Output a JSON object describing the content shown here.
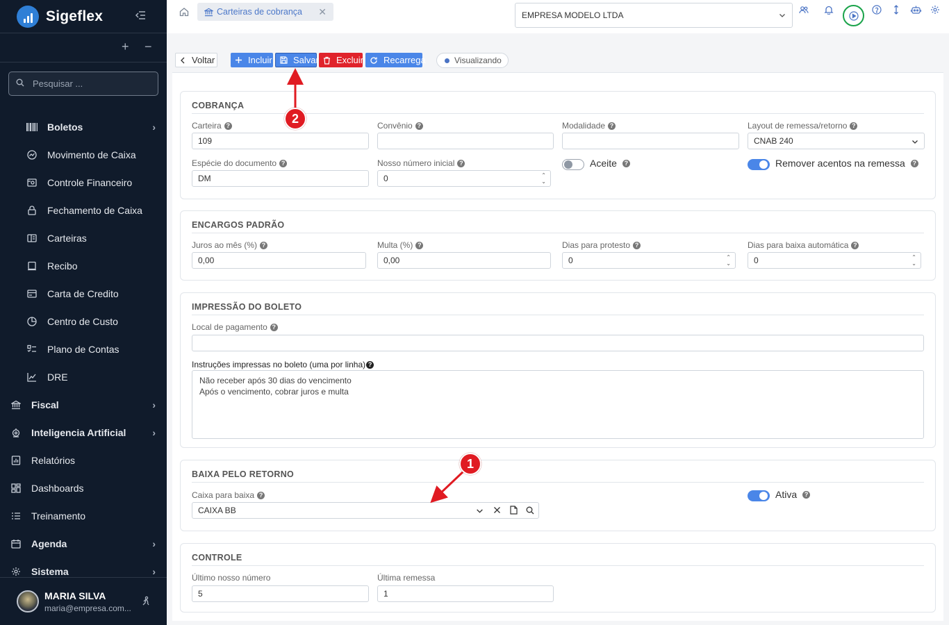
{
  "app": {
    "name": "Sigeflex",
    "search_placeholder": "Pesquisar ...",
    "tree_expand": "+",
    "tree_collapse": "−"
  },
  "sidebar": {
    "items": [
      {
        "label": "Boletos",
        "icon": "barcode-icon",
        "bold": true,
        "chevron": true
      },
      {
        "label": "Movimento de Caixa",
        "icon": "cash-flow-icon"
      },
      {
        "label": "Controle Financeiro",
        "icon": "finance-control-icon"
      },
      {
        "label": "Fechamento de Caixa",
        "icon": "lock-icon"
      },
      {
        "label": "Carteiras",
        "icon": "wallet-icon"
      },
      {
        "label": "Recibo",
        "icon": "receipt-icon"
      },
      {
        "label": "Carta de Credito",
        "icon": "credit-card-icon"
      },
      {
        "label": "Centro de Custo",
        "icon": "pie-chart-icon"
      },
      {
        "label": "Plano de Contas",
        "icon": "list-tree-icon"
      },
      {
        "label": "DRE",
        "icon": "line-chart-icon"
      },
      {
        "label": "Fiscal",
        "icon": "bank-icon",
        "bold": true,
        "chevron": true
      },
      {
        "label": "Inteligencia Artificial",
        "icon": "ai-icon",
        "bold": true,
        "chevron": true
      },
      {
        "label": "Relatórios",
        "icon": "report-icon"
      },
      {
        "label": "Dashboards",
        "icon": "dashboard-icon"
      },
      {
        "label": "Treinamento",
        "icon": "training-list-icon"
      },
      {
        "label": "Agenda",
        "icon": "calendar-icon",
        "bold": true,
        "chevron": true
      },
      {
        "label": "Sistema",
        "icon": "settings-icon",
        "bold": true,
        "chevron": true
      }
    ],
    "user": {
      "name": "MARIA SILVA",
      "email": "maria@empresa.com..."
    }
  },
  "topbar": {
    "tab_label": "Carteiras de cobrança",
    "company": "EMPRESA MODELO LTDA",
    "icons": [
      "users-icon",
      "bell-icon",
      "play-circle-icon",
      "help-circle-icon",
      "vertical-arrows-icon",
      "robot-icon",
      "gear-icon"
    ]
  },
  "toolbar": {
    "back": "Voltar",
    "incluir": "Incluir",
    "salvar": "Salvar",
    "excluir": "Excluir",
    "recarrega": "Recarrega",
    "status": "Visualizando"
  },
  "cobranca": {
    "title": "COBRANÇA",
    "carteira_label": "Carteira",
    "carteira_value": "109",
    "convenio_label": "Convênio",
    "convenio_value": "",
    "modalidade_label": "Modalidade",
    "modalidade_value": "",
    "layout_label": "Layout de remessa/retorno",
    "layout_value": "CNAB 240",
    "especie_label": "Espécie do documento",
    "especie_value": "DM",
    "nosso_label": "Nosso número inicial",
    "nosso_value": "0",
    "aceite_label": "Aceite",
    "aceite_on": false,
    "remover_label": "Remover acentos na remessa",
    "remover_on": true
  },
  "encargos": {
    "title": "ENCARGOS PADRÃO",
    "juros_label": "Juros ao mês (%)",
    "juros_value": "0,00",
    "multa_label": "Multa (%)",
    "multa_value": "0,00",
    "protesto_label": "Dias para protesto",
    "protesto_value": "0",
    "baixa_label": "Dias para baixa automática",
    "baixa_value": "0"
  },
  "impressao": {
    "title": "IMPRESSÃO DO BOLETO",
    "local_label": "Local de pagamento",
    "local_value": "",
    "instrucoes_label": "Instruções impressas no boleto (uma por linha)",
    "instrucoes_lines": [
      "Não receber após 30 dias do vencimento",
      "Após o vencimento, cobrar juros e multa"
    ]
  },
  "baixa_retorno": {
    "title": "BAIXA PELO RETORNO",
    "caixa_label": "Caixa para baixa",
    "caixa_value": "CAIXA BB",
    "ativa_label": "Ativa",
    "ativa_on": true
  },
  "controle": {
    "title": "CONTROLE",
    "ultimo_nosso_label": "Último nosso número",
    "ultimo_nosso_value": "5",
    "ultima_remessa_label": "Última remessa",
    "ultima_remessa_value": "1"
  },
  "annotations": {
    "marker_1": "1",
    "marker_2": "2",
    "color": "#e01b22",
    "highlight_color": "#1aa34a"
  }
}
